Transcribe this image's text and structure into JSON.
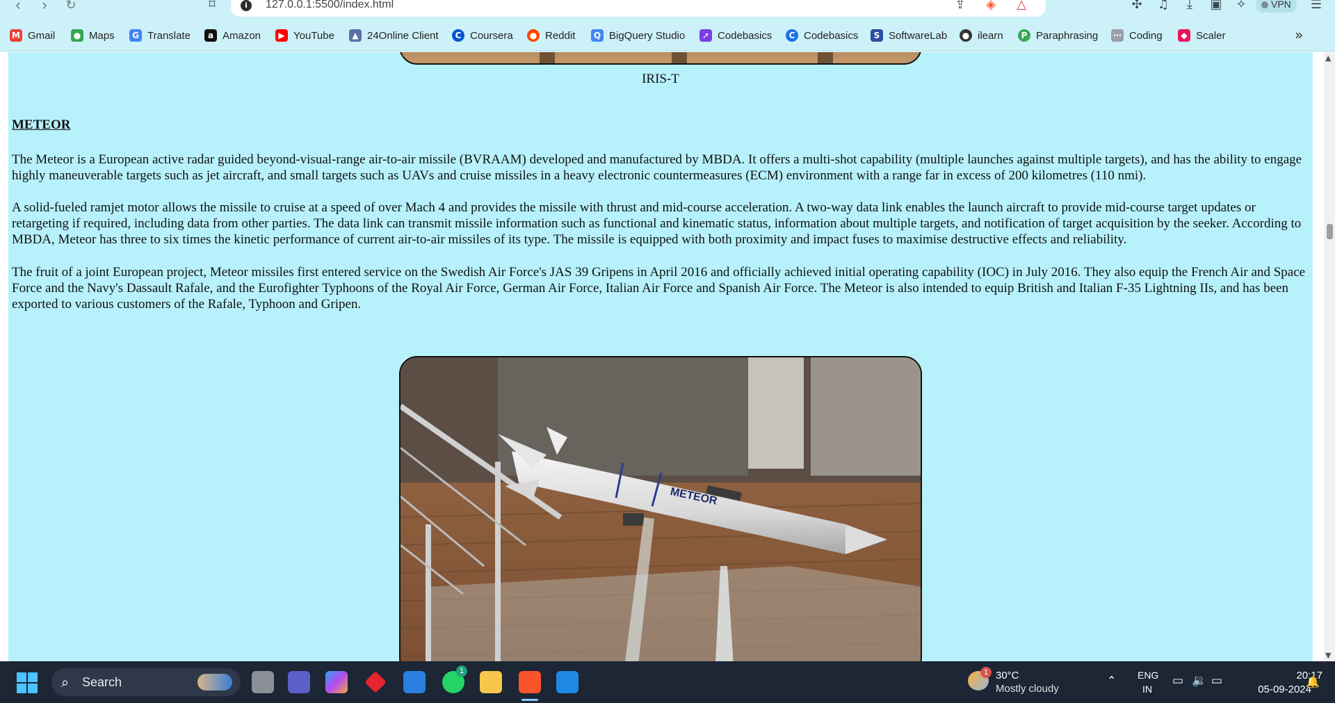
{
  "browser": {
    "url": "127.0.0.1:5500/index.html",
    "vpn_label": "VPN"
  },
  "bookmarks": [
    {
      "label": "Gmail",
      "icon": "gmail-icon",
      "color": "#ea4335",
      "glyph": "M"
    },
    {
      "label": "Maps",
      "icon": "maps-icon",
      "color": "#34a853",
      "glyph": "●"
    },
    {
      "label": "Translate",
      "icon": "translate-icon",
      "color": "#4285f4",
      "glyph": "G"
    },
    {
      "label": "Amazon",
      "icon": "amazon-icon",
      "color": "#111111",
      "glyph": "a"
    },
    {
      "label": "YouTube",
      "icon": "youtube-icon",
      "color": "#ff0000",
      "glyph": "▶"
    },
    {
      "label": "24Online Client",
      "icon": "24online-icon",
      "color": "#5a6fa8",
      "glyph": "▲"
    },
    {
      "label": "Coursera",
      "icon": "coursera-icon",
      "color": "#0056d2",
      "glyph": "C"
    },
    {
      "label": "Reddit",
      "icon": "reddit-icon",
      "color": "#ff4500",
      "glyph": "●"
    },
    {
      "label": "BigQuery Studio",
      "icon": "bigquery-icon",
      "color": "#4285f4",
      "glyph": "Q"
    },
    {
      "label": "Codebasics",
      "icon": "rocket-icon",
      "color": "#7b3fe4",
      "glyph": "➚"
    },
    {
      "label": "Codebasics",
      "icon": "codebasics-icon",
      "color": "#1a73e8",
      "glyph": "C"
    },
    {
      "label": "SoftwareLab",
      "icon": "softwarelab-icon",
      "color": "#2a4ea0",
      "glyph": "S"
    },
    {
      "label": "ilearn",
      "icon": "ilearn-icon",
      "color": "#333333",
      "glyph": "●"
    },
    {
      "label": "Paraphrasing",
      "icon": "paraphrasing-icon",
      "color": "#3aa757",
      "glyph": "P"
    },
    {
      "label": "Coding",
      "icon": "coding-icon",
      "color": "#9aa0a6",
      "glyph": "⋯"
    },
    {
      "label": "Scaler",
      "icon": "scaler-icon",
      "color": "#e8175d",
      "glyph": "◆"
    }
  ],
  "content": {
    "top_caption": "IRIS-T",
    "section_title": "METEOR",
    "paragraphs": [
      "The Meteor is a European active radar guided beyond-visual-range air-to-air missile (BVRAAM) developed and manufactured by MBDA. It offers a multi-shot capability (multiple launches against multiple targets), and has the ability to engage highly maneuverable targets such as jet aircraft, and small targets such as UAVs and cruise missiles in a heavy electronic countermeasures (ECM) environment with a range far in excess of 200 kilometres (110 nmi).",
      "A solid-fueled ramjet motor allows the missile to cruise at a speed of over Mach 4 and provides the missile with thrust and mid-course acceleration. A two-way data link enables the launch aircraft to provide mid-course target updates or retargeting if required, including data from other parties. The data link can transmit missile information such as functional and kinematic status, information about multiple targets, and notification of target acquisition by the seeker. According to MBDA, Meteor has three to six times the kinetic performance of current air-to-air missiles of its type. The missile is equipped with both proximity and impact fuses to maximise destructive effects and reliability.",
      "The fruit of a joint European project, Meteor missiles first entered service on the Swedish Air Force's JAS 39 Gripens in April 2016 and officially achieved initial operating capability (IOC) in July 2016. They also equip the French Air and Space Force and the Navy's Dassault Rafale, and the Eurofighter Typhoons of the Royal Air Force, German Air Force, Italian Air Force and Spanish Air Force. The Meteor is also intended to equip British and Italian F-35 Lightning IIs, and has been exported to various customers of the Rafale, Typhoon and Gripen."
    ],
    "missile_label": "METEOR"
  },
  "taskbar": {
    "search_label": "Search",
    "whatsapp_badge": "1",
    "weather_badge": "1",
    "weather_temp": "30°C",
    "weather_desc": "Mostly cloudy",
    "lang_line1": "ENG",
    "lang_line2": "IN",
    "time": "20:17",
    "date": "05-09-2024"
  },
  "colors": {
    "page_bg": "#b7f1fc",
    "browser_chrome": "#cdf1f8",
    "taskbar": "#1c2634"
  }
}
